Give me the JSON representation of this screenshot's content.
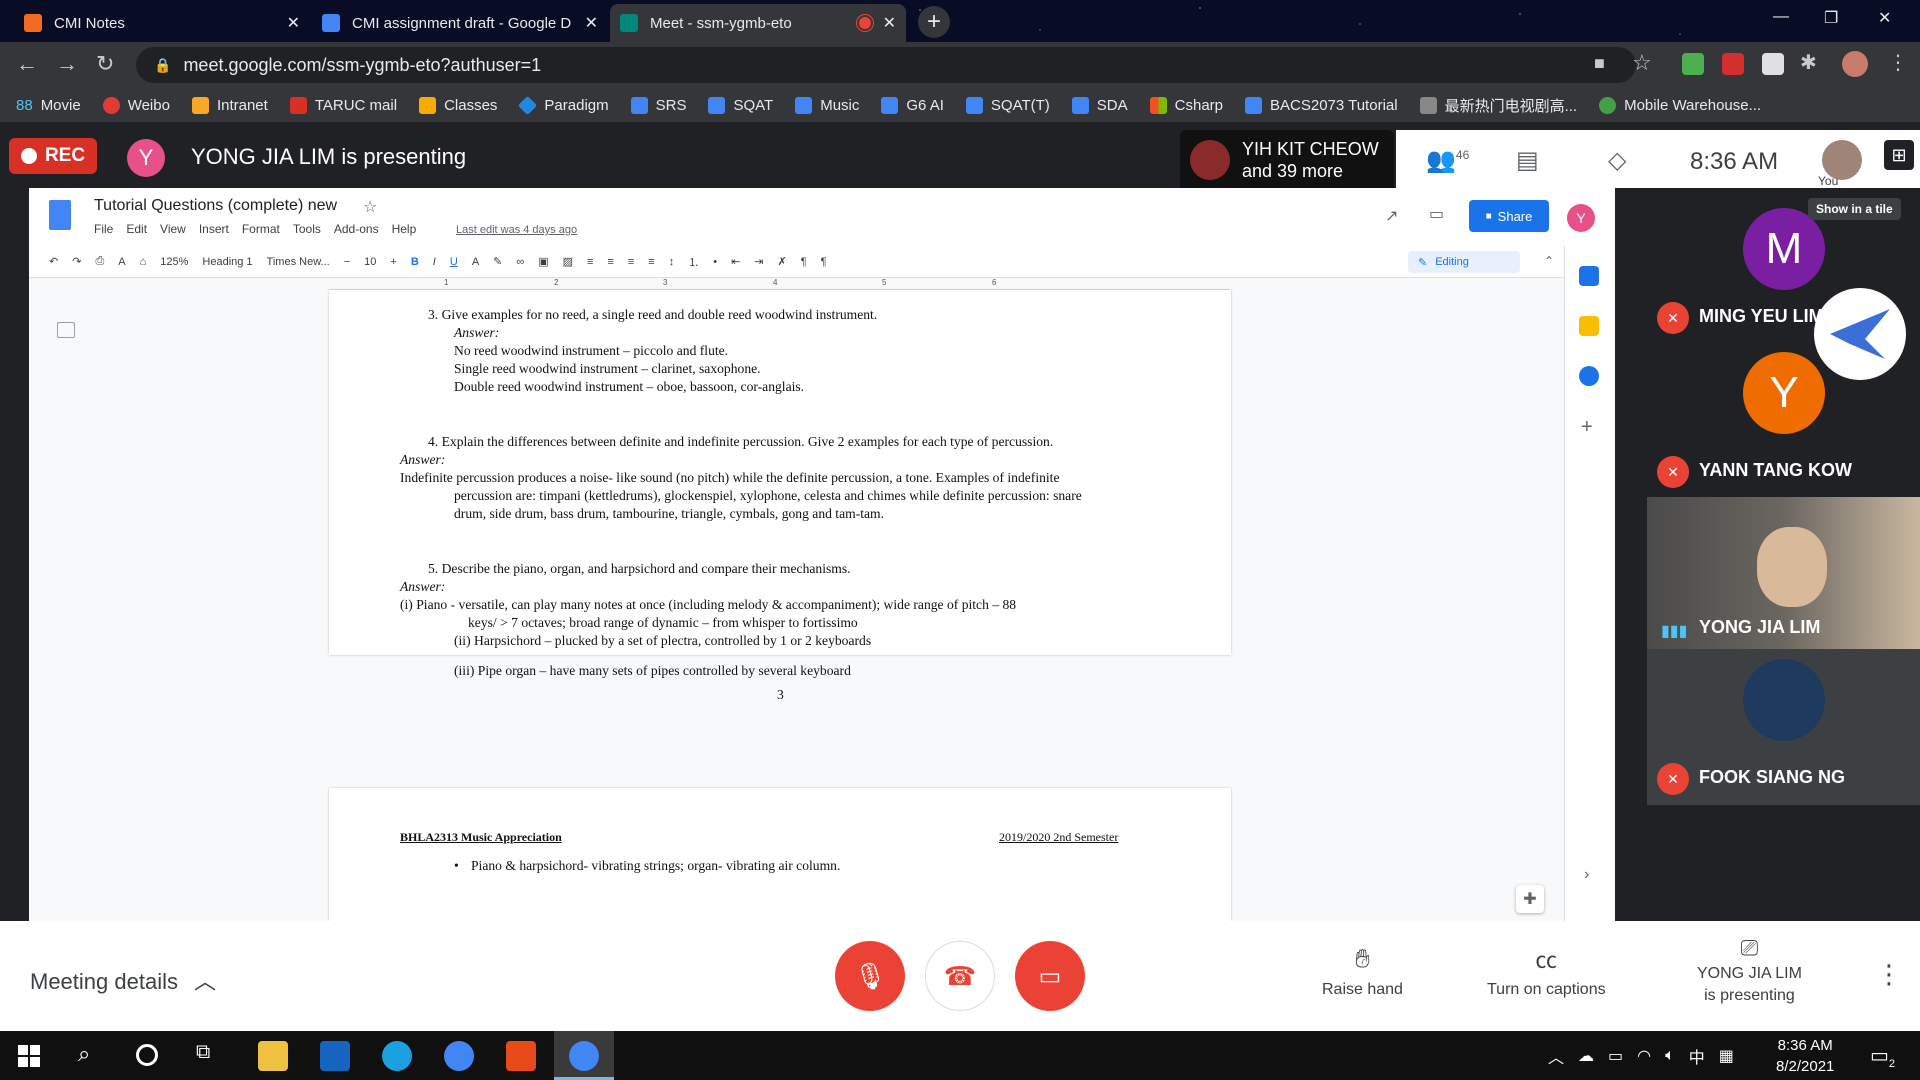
{
  "browser": {
    "tabs": [
      {
        "title": "CMI Notes",
        "icon_color": "#f26b21"
      },
      {
        "title": "CMI assignment draft - Google D",
        "icon_color": "#4285f4"
      },
      {
        "title": "Meet - ssm-ygmb-eto",
        "icon_color": "#00897b"
      }
    ],
    "url": "meet.google.com/ssm-ygmb-eto?authuser=1",
    "bookmarks": [
      {
        "label": "Movie",
        "prefix": "88",
        "color": "#4fc3f7"
      },
      {
        "label": "Weibo",
        "color": "#e53935"
      },
      {
        "label": "Intranet",
        "color": "#f9a825"
      },
      {
        "label": "TARUC mail",
        "color": "#d93025"
      },
      {
        "label": "Classes",
        "color": "#f9ab00"
      },
      {
        "label": "Paradigm",
        "color": "#1e88e5"
      },
      {
        "label": "SRS",
        "color": "#4285f4"
      },
      {
        "label": "SQAT",
        "color": "#4285f4"
      },
      {
        "label": "Music",
        "color": "#4285f4"
      },
      {
        "label": "G6 AI",
        "color": "#4285f4"
      },
      {
        "label": "SQAT(T)",
        "color": "#4285f4"
      },
      {
        "label": "SDA",
        "color": "#4285f4"
      },
      {
        "label": "Csharp",
        "color": "#f25022"
      },
      {
        "label": "BACS2073 Tutorial",
        "color": "#4285f4"
      },
      {
        "label": "最新热门电视剧高...",
        "color": "#888888"
      },
      {
        "label": "Mobile Warehouse...",
        "color": "#43a047"
      }
    ]
  },
  "meet": {
    "rec_label": "REC",
    "presenter_initial": "Y",
    "presenting_text": "YONG JIA LIM is presenting",
    "featured_name": "YIH KIT CHEOW",
    "featured_more": "and 39 more",
    "people_count": "46",
    "clock": "8:36 AM",
    "you_label": "You",
    "show_tile_label": "Show in a tile",
    "participants": [
      {
        "name": "MING YEU LIM",
        "initial": "M",
        "color": "#7b1fa2",
        "muted": true
      },
      {
        "name": "YANN TANG KOW",
        "initial": "Y",
        "color": "#ef6c00",
        "muted": true
      },
      {
        "name": "YONG JIA LIM",
        "initial": "",
        "color": "#5f6368",
        "muted": false
      },
      {
        "name": "FOOK SIANG NG",
        "initial": "",
        "color": "#3c4043",
        "muted": true
      }
    ],
    "bottom": {
      "meeting_details": "Meeting details",
      "raise_hand": "Raise hand",
      "captions": "Turn on captions",
      "presenting_line1": "YONG JIA LIM",
      "presenting_line2": "is presenting"
    }
  },
  "doc": {
    "title": "Tutorial Questions (complete) new",
    "menus": [
      "File",
      "Edit",
      "View",
      "Insert",
      "Format",
      "Tools",
      "Add-ons",
      "Help"
    ],
    "last_edit": "Last edit was 4 days ago",
    "share_label": "Share",
    "user_initial": "Y",
    "zoom": "125%",
    "style": "Heading 1",
    "font": "Times New...",
    "font_size": "10",
    "editing_label": "Editing",
    "ruler_marks": [
      "1",
      "2",
      "3",
      "4",
      "5",
      "6"
    ],
    "page1_lines": [
      "3.    Give examples for no reed, a single reed and double reed woodwind instrument.",
      "Answer:",
      "No reed woodwind instrument – piccolo and flute.",
      "Single reed woodwind instrument – clarinet, saxophone.",
      "Double reed woodwind instrument – oboe, bassoon, cor-anglais.",
      "4.    Explain the differences between definite and indefinite percussion. Give 2 examples for each type of percussion.",
      "Answer:",
      "Indefinite percussion produces a noise- like sound (no pitch) while the definite percussion, a tone. Examples of indefinite",
      "percussion are: timpani (kettledrums), glockenspiel, xylophone, celesta and chimes while definite percussion: snare",
      "drum, side drum, bass drum, tambourine, triangle, cymbals, gong and tam-tam.",
      "5.    Describe the piano, organ, and harpsichord and compare their mechanisms.",
      "Answer:",
      "(i) Piano  - versatile, can play many notes at once (including melody & accompaniment); wide range of pitch – 88",
      "keys/ > 7 octaves; broad range of dynamic – from whisper to fortissimo",
      "(ii) Harpsichord – plucked by a set of plectra, controlled by 1 or 2 keyboards",
      "(iii) Pipe organ – have many sets of pipes controlled by several keyboard",
      "3"
    ],
    "page2_header_left": "BHLA2313 Music Appreciation",
    "page2_header_right": "2019/2020 2nd Semester",
    "page2_bullet": "Piano & harpsichord- vibrating strings; organ- vibrating air column."
  },
  "taskbar": {
    "time": "8:36 AM",
    "date": "8/2/2021",
    "ime": "中",
    "notif_count": "2"
  }
}
